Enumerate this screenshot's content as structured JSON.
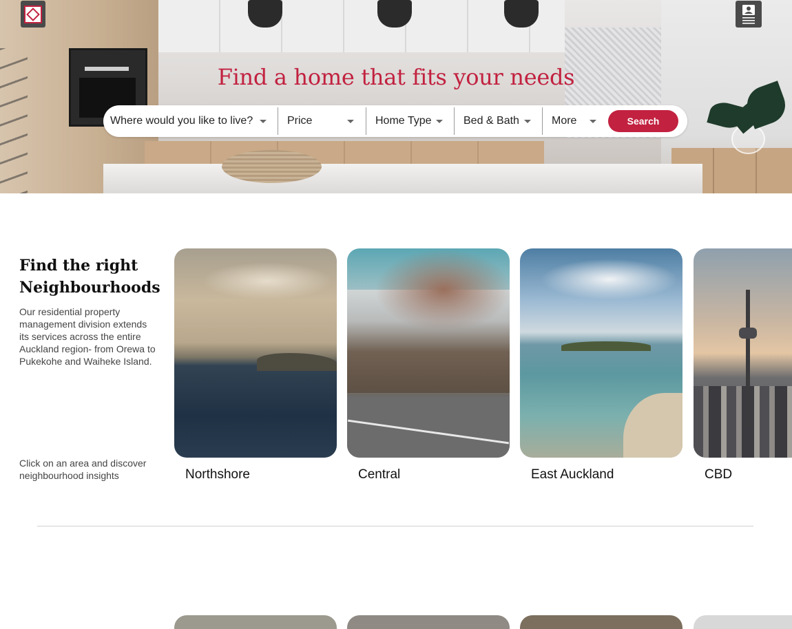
{
  "hero": {
    "title": "Find a home that fits your needs"
  },
  "search": {
    "location_label": "Where would you like to live?",
    "price_label": "Price",
    "home_type_label": "Home Type",
    "bed_bath_label": "Bed & Bath",
    "more_label": "More",
    "button_label": "Search"
  },
  "neighbourhoods": {
    "title": "Find the right Neighbourhoods",
    "description": "Our residential property management division extends its services across the entire Auckland region- from Orewa to Pukekohe and Waiheke Island.",
    "hint": "Click on an area and discover neighbourhood insights",
    "cards": [
      {
        "name": "Northshore"
      },
      {
        "name": "Central"
      },
      {
        "name": "East Auckland"
      },
      {
        "name": "CBD"
      }
    ]
  },
  "colors": {
    "accent": "#c2213f",
    "header_button_bg": "#4a4a4a"
  },
  "icons": {
    "logo": "company-logo",
    "contact": "contact-card-icon",
    "dropdown": "caret-down-icon"
  }
}
